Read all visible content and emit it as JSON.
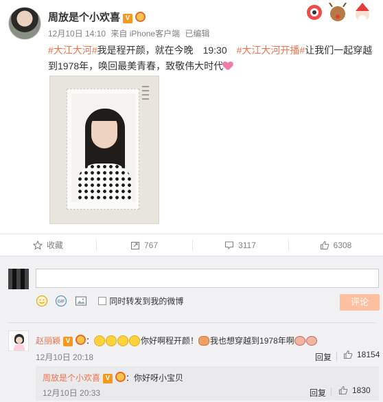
{
  "post": {
    "author": "周放是个小欢喜",
    "verified_badge": "V",
    "timestamp": "12月10日 14:10",
    "source": "来自 iPhone客户端",
    "edited": "已编辑",
    "text_parts": {
      "tag1": "#大江大河#",
      "text1": "我是程开颜，就在今晚　19:30　",
      "tag2": "#大江大河开播#",
      "text2": "让我们一起穿越到1978年，唤回最美青春，致敬伟大时代"
    }
  },
  "actions": {
    "favorite_label": "收藏",
    "forward_count": "767",
    "comment_count": "3117",
    "like_count": "6308"
  },
  "composer": {
    "input_value": "",
    "sync_label": "同时转发到我的微博",
    "submit_label": "评论"
  },
  "comment": {
    "author": "赵丽颖",
    "badge": "V",
    "colon": "：",
    "text1": "你好啊程开颜！",
    "text2": "我也想穿越到1978年啊",
    "time": "12月10日 20:18",
    "reply_label": "回复",
    "like_count": "18154"
  },
  "reply": {
    "author": "周放是个小欢喜",
    "badge": "V",
    "colon": "：",
    "text": "你好呀小宝贝",
    "time": "12月10日 20:33",
    "reply_label": "回复",
    "like_count": "1830"
  },
  "colors": {
    "accent": "#eb7350",
    "submit_bg": "#ffc09f",
    "badge": "#f39a1e"
  }
}
